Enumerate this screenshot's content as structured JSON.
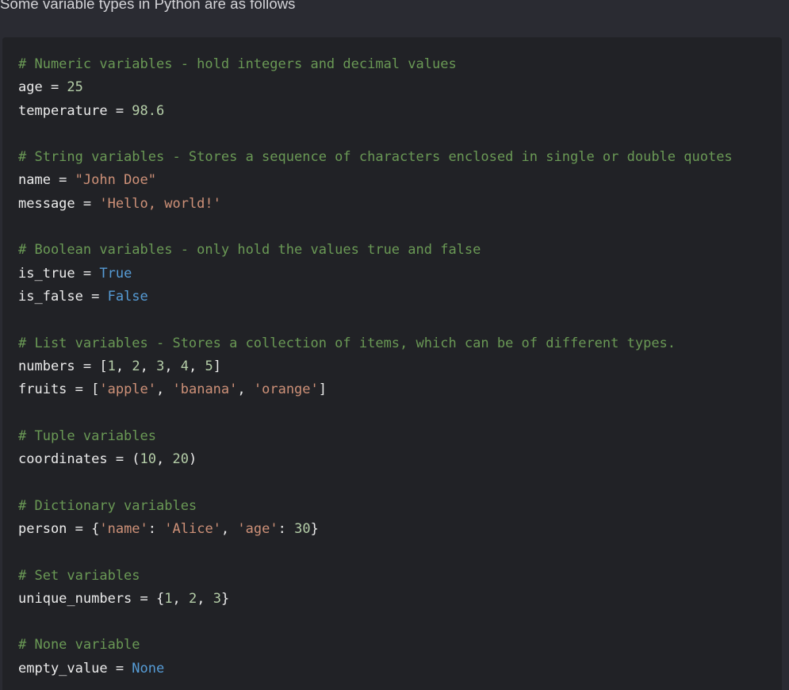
{
  "intro_text": "Some variable types in Python are as follows",
  "code_lines": [
    [
      {
        "t": "# Numeric variables - hold integers and decimal values",
        "k": "cm"
      }
    ],
    [
      {
        "t": "age = ",
        "k": "tx"
      },
      {
        "t": "25",
        "k": "nm"
      }
    ],
    [
      {
        "t": "temperature = ",
        "k": "tx"
      },
      {
        "t": "98.6",
        "k": "nm"
      }
    ],
    [],
    [
      {
        "t": "# String variables - Stores a sequence of characters enclosed in single or double quotes",
        "k": "cm"
      }
    ],
    [
      {
        "t": "name = ",
        "k": "tx"
      },
      {
        "t": "\"John Doe\"",
        "k": "st"
      }
    ],
    [
      {
        "t": "message = ",
        "k": "tx"
      },
      {
        "t": "'Hello, world!'",
        "k": "st"
      }
    ],
    [],
    [
      {
        "t": "# Boolean variables - only hold the values true and false",
        "k": "cm"
      }
    ],
    [
      {
        "t": "is_true = ",
        "k": "tx"
      },
      {
        "t": "True",
        "k": "kw"
      }
    ],
    [
      {
        "t": "is_false = ",
        "k": "tx"
      },
      {
        "t": "False",
        "k": "kw"
      }
    ],
    [],
    [
      {
        "t": "# List variables - Stores a collection of items, which can be of different types.",
        "k": "cm"
      }
    ],
    [
      {
        "t": "numbers = [",
        "k": "tx"
      },
      {
        "t": "1",
        "k": "nm"
      },
      {
        "t": ", ",
        "k": "tx"
      },
      {
        "t": "2",
        "k": "nm"
      },
      {
        "t": ", ",
        "k": "tx"
      },
      {
        "t": "3",
        "k": "nm"
      },
      {
        "t": ", ",
        "k": "tx"
      },
      {
        "t": "4",
        "k": "nm"
      },
      {
        "t": ", ",
        "k": "tx"
      },
      {
        "t": "5",
        "k": "nm"
      },
      {
        "t": "]",
        "k": "tx"
      }
    ],
    [
      {
        "t": "fruits = [",
        "k": "tx"
      },
      {
        "t": "'apple'",
        "k": "st"
      },
      {
        "t": ", ",
        "k": "tx"
      },
      {
        "t": "'banana'",
        "k": "st"
      },
      {
        "t": ", ",
        "k": "tx"
      },
      {
        "t": "'orange'",
        "k": "st"
      },
      {
        "t": "]",
        "k": "tx"
      }
    ],
    [],
    [
      {
        "t": "# Tuple variables",
        "k": "cm"
      }
    ],
    [
      {
        "t": "coordinates = (",
        "k": "tx"
      },
      {
        "t": "10",
        "k": "nm"
      },
      {
        "t": ", ",
        "k": "tx"
      },
      {
        "t": "20",
        "k": "nm"
      },
      {
        "t": ")",
        "k": "tx"
      }
    ],
    [],
    [
      {
        "t": "# Dictionary variables",
        "k": "cm"
      }
    ],
    [
      {
        "t": "person = {",
        "k": "tx"
      },
      {
        "t": "'name'",
        "k": "st"
      },
      {
        "t": ": ",
        "k": "tx"
      },
      {
        "t": "'Alice'",
        "k": "st"
      },
      {
        "t": ", ",
        "k": "tx"
      },
      {
        "t": "'age'",
        "k": "st"
      },
      {
        "t": ": ",
        "k": "tx"
      },
      {
        "t": "30",
        "k": "nm"
      },
      {
        "t": "}",
        "k": "tx"
      }
    ],
    [],
    [
      {
        "t": "# Set variables",
        "k": "cm"
      }
    ],
    [
      {
        "t": "unique_numbers = {",
        "k": "tx"
      },
      {
        "t": "1",
        "k": "nm"
      },
      {
        "t": ", ",
        "k": "tx"
      },
      {
        "t": "2",
        "k": "nm"
      },
      {
        "t": ", ",
        "k": "tx"
      },
      {
        "t": "3",
        "k": "nm"
      },
      {
        "t": "}",
        "k": "tx"
      }
    ],
    [],
    [
      {
        "t": "# None variable",
        "k": "cm"
      }
    ],
    [
      {
        "t": "empty_value = ",
        "k": "tx"
      },
      {
        "t": "None",
        "k": "kw"
      }
    ]
  ],
  "colors": {
    "page_background": "#2a2b32",
    "code_background": "#212226",
    "comment": "#6a9955",
    "string": "#ce9178",
    "keyword": "#569cd6",
    "number": "#b5cea8",
    "text": "#ececec"
  }
}
